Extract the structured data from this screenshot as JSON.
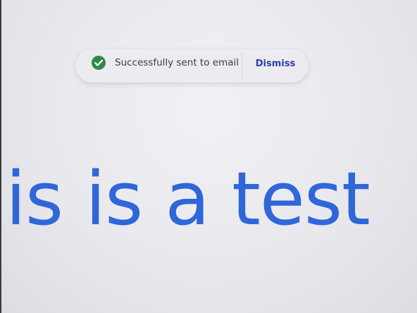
{
  "toast": {
    "icon": "check-circle-icon",
    "message": "Successfully sent to email",
    "dismiss_label": "Dismiss",
    "success_color": "#2e8b47",
    "accent_color": "#2f3fa6"
  },
  "document": {
    "visible_text": "is is a test",
    "text_color": "#2f67d8"
  }
}
